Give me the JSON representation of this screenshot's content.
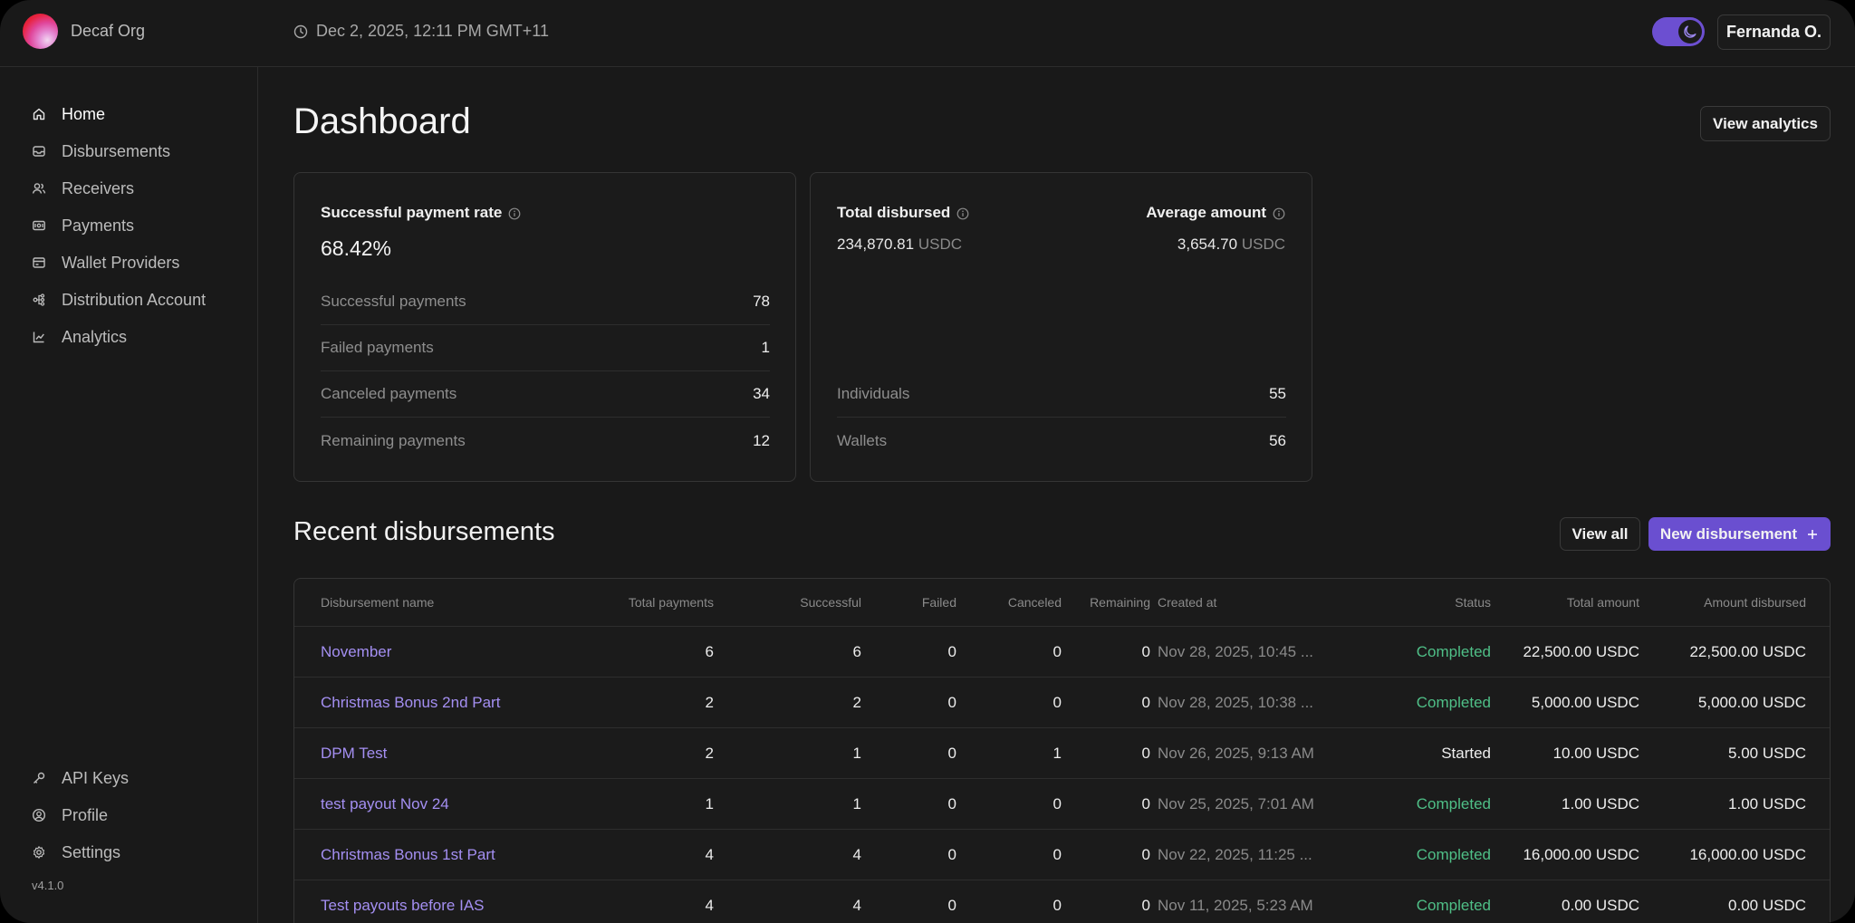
{
  "header": {
    "org_name": "Decaf Org",
    "datetime": "Dec 2, 2025, 12:11 PM GMT+11",
    "user_label": "Fernanda O.",
    "theme_toggle_on": true
  },
  "sidebar": {
    "items": [
      {
        "label": "Home",
        "icon": "home-icon",
        "active": true
      },
      {
        "label": "Disbursements",
        "icon": "inbox-icon"
      },
      {
        "label": "Receivers",
        "icon": "users-icon"
      },
      {
        "label": "Payments",
        "icon": "payments-icon"
      },
      {
        "label": "Wallet Providers",
        "icon": "wallet-icon"
      },
      {
        "label": "Distribution Account",
        "icon": "distribution-icon"
      },
      {
        "label": "Analytics",
        "icon": "chart-icon"
      }
    ],
    "bottom_items": [
      {
        "label": "API Keys",
        "icon": "key-icon"
      },
      {
        "label": "Profile",
        "icon": "user-circle-icon"
      },
      {
        "label": "Settings",
        "icon": "gear-icon"
      }
    ],
    "version": "v4.1.0"
  },
  "page": {
    "title": "Dashboard",
    "view_analytics_label": "View analytics"
  },
  "payment_card": {
    "label": "Successful payment rate",
    "rate": "68.42%",
    "rows": [
      {
        "label": "Successful payments",
        "value": "78"
      },
      {
        "label": "Failed payments",
        "value": "1"
      },
      {
        "label": "Canceled payments",
        "value": "34"
      },
      {
        "label": "Remaining payments",
        "value": "12"
      }
    ]
  },
  "disbursed_card": {
    "total_label": "Total disbursed",
    "total_value": "234,870.81",
    "total_unit": "USDC",
    "avg_label": "Average amount",
    "avg_value": "3,654.70",
    "avg_unit": "USDC",
    "rows": [
      {
        "label": "Individuals",
        "value": "55"
      },
      {
        "label": "Wallets",
        "value": "56"
      }
    ]
  },
  "recent": {
    "title": "Recent disbursements",
    "view_all_label": "View all",
    "new_label": "New disbursement",
    "columns": [
      "Disbursement name",
      "Total payments",
      "Successful",
      "Failed",
      "Canceled",
      "Remaining",
      "Created at",
      "Status",
      "Total amount",
      "Amount disbursed"
    ],
    "rows": [
      {
        "name": "November",
        "total": "6",
        "successful": "6",
        "failed": "0",
        "canceled": "0",
        "remaining": "0",
        "created": "Nov 28, 2025, 10:45 ...",
        "status": "Completed",
        "total_amount": "22,500.00 USDC",
        "disbursed": "22,500.00 USDC"
      },
      {
        "name": "Christmas Bonus 2nd Part",
        "total": "2",
        "successful": "2",
        "failed": "0",
        "canceled": "0",
        "remaining": "0",
        "created": "Nov 28, 2025, 10:38 ...",
        "status": "Completed",
        "total_amount": "5,000.00 USDC",
        "disbursed": "5,000.00 USDC"
      },
      {
        "name": "DPM Test",
        "total": "2",
        "successful": "1",
        "failed": "0",
        "canceled": "1",
        "remaining": "0",
        "created": "Nov 26, 2025, 9:13 AM",
        "status": "Started",
        "total_amount": "10.00 USDC",
        "disbursed": "5.00 USDC"
      },
      {
        "name": "test payout Nov 24",
        "total": "1",
        "successful": "1",
        "failed": "0",
        "canceled": "0",
        "remaining": "0",
        "created": "Nov 25, 2025, 7:01 AM",
        "status": "Completed",
        "total_amount": "1.00 USDC",
        "disbursed": "1.00 USDC"
      },
      {
        "name": "Christmas Bonus 1st Part",
        "total": "4",
        "successful": "4",
        "failed": "0",
        "canceled": "0",
        "remaining": "0",
        "created": "Nov 22, 2025, 11:25 ...",
        "status": "Completed",
        "total_amount": "16,000.00 USDC",
        "disbursed": "16,000.00 USDC"
      },
      {
        "name": "Test payouts before IAS",
        "total": "4",
        "successful": "4",
        "failed": "0",
        "canceled": "0",
        "remaining": "0",
        "created": "Nov 11, 2025, 5:23 AM",
        "status": "Completed",
        "total_amount": "0.00 USDC",
        "disbursed": "0.00 USDC"
      }
    ]
  },
  "colors": {
    "accent": "#6a4fd0",
    "link": "#a48ff2",
    "completed": "#4fbf87",
    "background": "#191919"
  }
}
